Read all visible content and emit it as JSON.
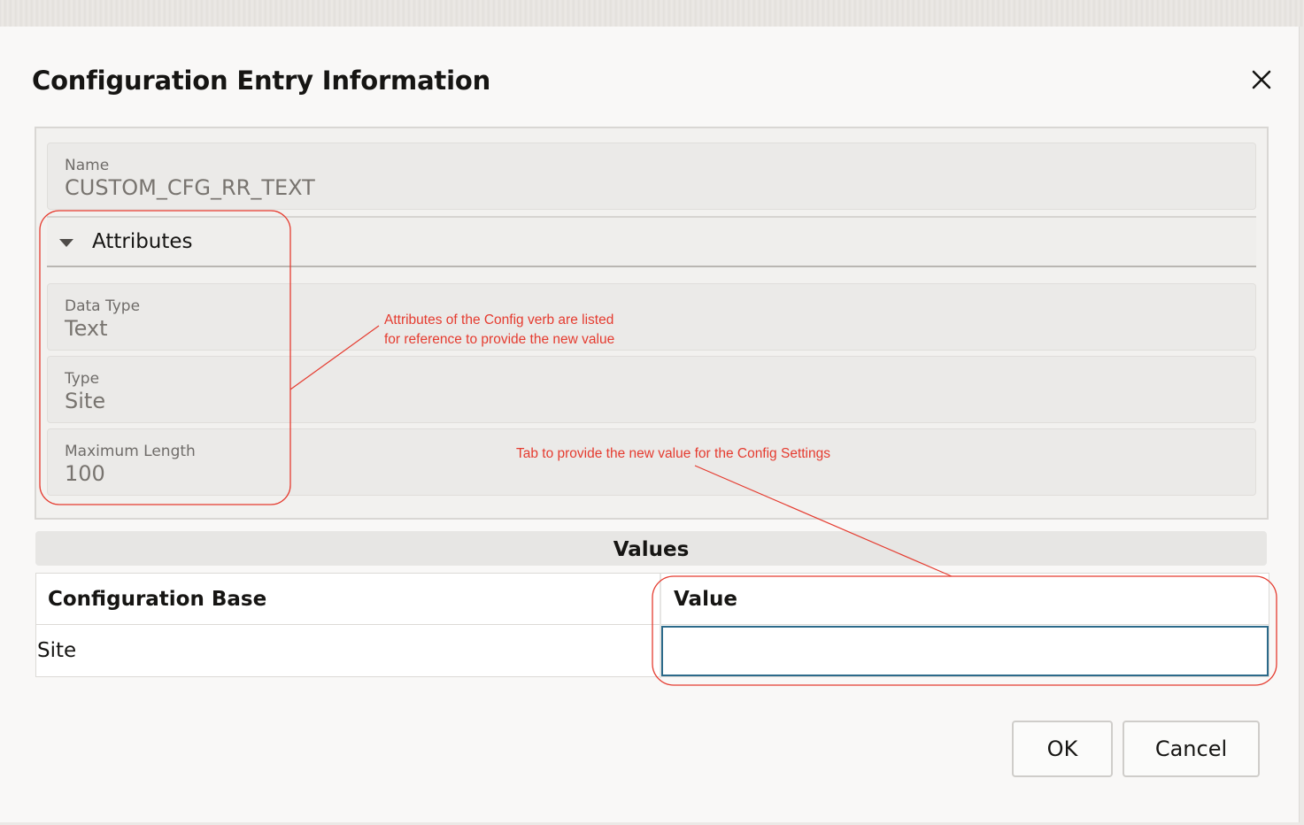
{
  "dialog": {
    "title": "Configuration Entry Information",
    "close_icon": "close-icon"
  },
  "name_field": {
    "label": "Name",
    "value": "CUSTOM_CFG_RR_TEXT"
  },
  "attributes": {
    "header": "Attributes",
    "expanded": true,
    "fields": [
      {
        "label": "Data Type",
        "value": "Text"
      },
      {
        "label": "Type",
        "value": "Site"
      },
      {
        "label": "Maximum Length",
        "value": "100"
      }
    ]
  },
  "values": {
    "header": "Values",
    "columns": [
      "Configuration Base",
      "Value"
    ],
    "rows": [
      {
        "base": "Site",
        "value": ""
      }
    ]
  },
  "buttons": {
    "ok": "OK",
    "cancel": "Cancel"
  },
  "annotations": {
    "attributes_note_line1": "Attributes of the Config verb are listed",
    "attributes_note_line2": "for reference to provide the new value",
    "value_note": "Tab to provide the new value for the Config Settings",
    "color": "#e53b2f"
  },
  "colors": {
    "input_focus_border": "#2c6a8a",
    "dialog_background": "#f9f8f7"
  }
}
